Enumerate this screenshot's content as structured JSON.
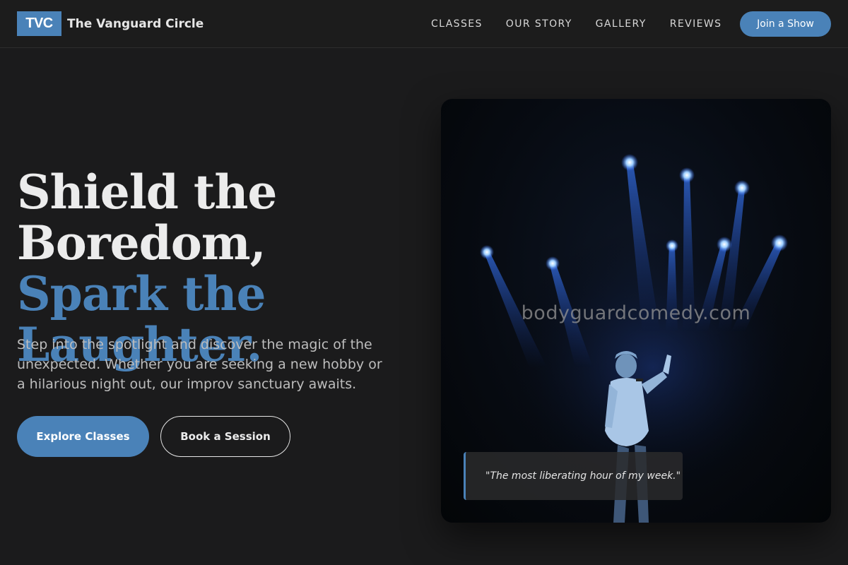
{
  "nav": {
    "logo_text": "TVC",
    "brand_name": "The Vanguard Circle",
    "links": [
      "CLASSES",
      "OUR STORY",
      "GALLERY",
      "REVIEWS"
    ],
    "cta_label": "Join a Show"
  },
  "hero": {
    "title_part1": "Shield the Boredom, ",
    "title_accent": "Spark the Laughter.",
    "subtitle": "Step into the spotlight and discover the magic of the unexpected. Whether you are seeking a new hobby or a hilarious night out, our improv sanctuary awaits.",
    "primary_button": "Explore Classes",
    "secondary_button": "Book a Session"
  },
  "image": {
    "watermark": "bodyguardcomedy.com",
    "quote": "\"The most liberating hour of my week.\""
  },
  "colors": {
    "accent": "#4a82b8",
    "background": "#1b1b1c"
  }
}
